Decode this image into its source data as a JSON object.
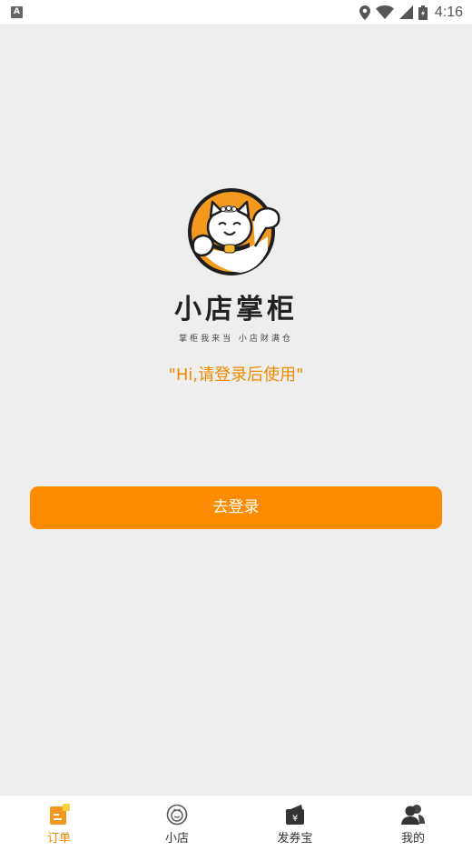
{
  "status_bar": {
    "app_badge": "A",
    "time": "4:16",
    "icons": [
      "location-icon",
      "wifi-icon",
      "cell-signal-icon",
      "battery-charging-icon"
    ]
  },
  "brand": {
    "title": "小店掌柜",
    "slogan": "掌柜我来当 小店财满仓",
    "logo": "lucky-cat-logo"
  },
  "greeting": "\"Hi,请登录后使用\"",
  "login_button": "去登录",
  "colors": {
    "accent": "#ff8c00",
    "greeting_text": "#f08a00",
    "background": "#eeeeee"
  },
  "tabbar": {
    "items": [
      {
        "label": "订单",
        "icon": "order-icon",
        "active": true
      },
      {
        "label": "小店",
        "icon": "shop-icon",
        "active": false
      },
      {
        "label": "发券宝",
        "icon": "coupon-wallet-icon",
        "active": false
      },
      {
        "label": "我的",
        "icon": "user-group-icon",
        "active": false
      }
    ]
  }
}
